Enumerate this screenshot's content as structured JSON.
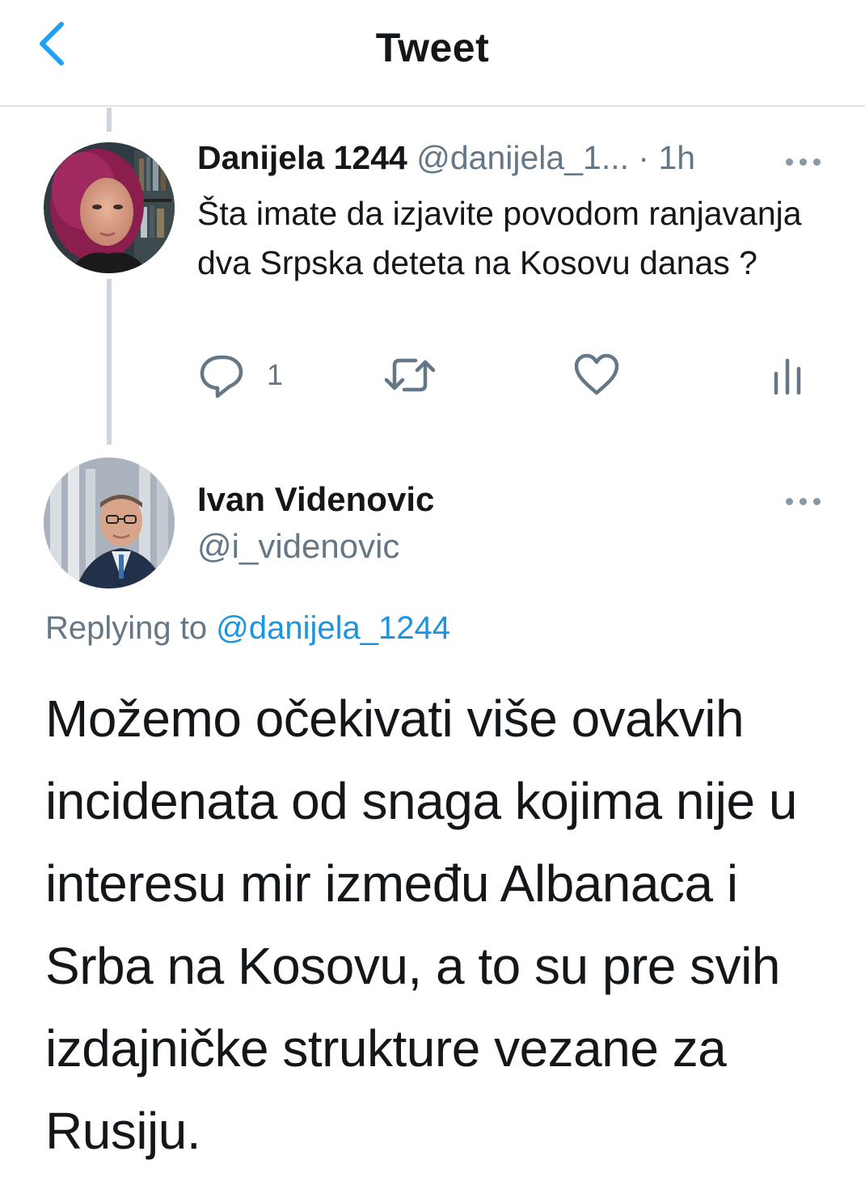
{
  "header": {
    "title": "Tweet",
    "back_icon": "chevron-left-icon",
    "accent_color": "#1da1f2"
  },
  "parent_tweet": {
    "author_name": "Danijela 1244",
    "author_handle": "@danijela_1...",
    "time": "· 1h",
    "text": "Šta imate da izjavite povodom ranjavanja dva Srpska deteta na Kosovu danas ?",
    "reply_count": "1",
    "actions": [
      "reply-icon",
      "retweet-icon",
      "like-icon",
      "analytics-icon"
    ],
    "more_icon": "more-dots-icon"
  },
  "main_tweet": {
    "author_name": "Ivan Videnovic",
    "author_handle": "@i_videnovic",
    "replying_label": "Replying to",
    "replying_mention": "@danijela_1244",
    "text": "Možemo očekivati više ovakvih incidenata od snaga kojima nije u interesu mir između Albanaca i Srba na Kosovu, a to su pre svih izdajničke strukture vezane za Rusiju.",
    "more_icon": "more-dots-icon",
    "mention_color": "#1b95e0"
  }
}
